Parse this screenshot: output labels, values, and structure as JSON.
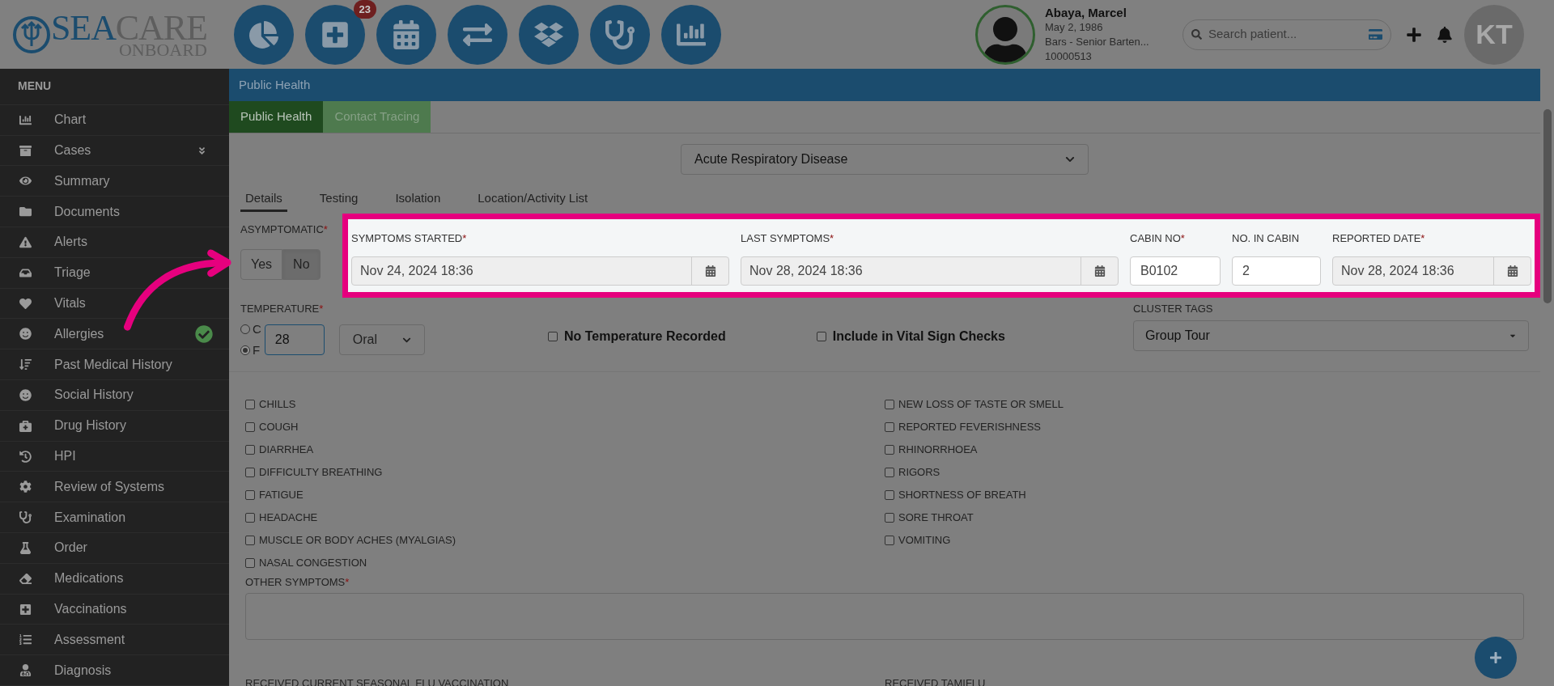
{
  "logo": {
    "part_a": "SEA",
    "part_b": "CARE",
    "sub": "ONBOARD"
  },
  "toolbar": {
    "badge": "23"
  },
  "patient": {
    "name": "Abaya, Marcel",
    "dob": "May 2, 1986",
    "role": "Bars - Senior Barten...",
    "id": "10000513"
  },
  "search": {
    "placeholder": "Search patient..."
  },
  "user": {
    "initials": "KT"
  },
  "sidebar": {
    "title": "MENU",
    "items": [
      {
        "label": "Chart",
        "expandable": false,
        "verified": false
      },
      {
        "label": "Cases",
        "expandable": true,
        "verified": false
      },
      {
        "label": "Summary",
        "expandable": false,
        "verified": false
      },
      {
        "label": "Documents",
        "expandable": false,
        "verified": false
      },
      {
        "label": "Alerts",
        "expandable": false,
        "verified": false
      },
      {
        "label": "Triage",
        "expandable": false,
        "verified": false
      },
      {
        "label": "Vitals",
        "expandable": false,
        "verified": false
      },
      {
        "label": "Allergies",
        "expandable": false,
        "verified": true
      },
      {
        "label": "Past Medical History",
        "expandable": false,
        "verified": false
      },
      {
        "label": "Social History",
        "expandable": false,
        "verified": false
      },
      {
        "label": "Drug History",
        "expandable": false,
        "verified": false
      },
      {
        "label": "HPI",
        "expandable": false,
        "verified": false
      },
      {
        "label": "Review of Systems",
        "expandable": false,
        "verified": false
      },
      {
        "label": "Examination",
        "expandable": false,
        "verified": false
      },
      {
        "label": "Order",
        "expandable": false,
        "verified": false
      },
      {
        "label": "Medications",
        "expandable": false,
        "verified": false
      },
      {
        "label": "Vaccinations",
        "expandable": false,
        "verified": false
      },
      {
        "label": "Assessment",
        "expandable": false,
        "verified": false
      },
      {
        "label": "Diagnosis",
        "expandable": false,
        "verified": false
      }
    ]
  },
  "page_title": "Public Health",
  "tabs": [
    {
      "label": "Public Health",
      "selected": true
    },
    {
      "label": "Contact Tracing",
      "selected": false
    }
  ],
  "disease_select": {
    "value": "Acute Respiratory Disease"
  },
  "subtabs": [
    {
      "label": "Details",
      "selected": true
    },
    {
      "label": "Testing",
      "selected": false
    },
    {
      "label": "Isolation",
      "selected": false
    },
    {
      "label": "Location/Activity List",
      "selected": false
    }
  ],
  "asymptomatic": {
    "label": "ASYMPTOMATIC",
    "required_mark": "*",
    "options": [
      {
        "label": "Yes",
        "selected": false
      },
      {
        "label": "No",
        "selected": true
      }
    ]
  },
  "symptom_fields": [
    {
      "label": "SYMPTOMS STARTED",
      "required_mark": "*",
      "value": "Nov 24, 2024 18:36",
      "kind": "date"
    },
    {
      "label": "LAST SYMPTOMS",
      "required_mark": "*",
      "value": "Nov 28, 2024 18:36",
      "kind": "date"
    },
    {
      "label": "CABIN NO",
      "required_mark": "*",
      "value": "B0102",
      "kind": "text"
    },
    {
      "label": "NO. IN CABIN",
      "value": "2",
      "kind": "text"
    },
    {
      "label": "REPORTED DATE",
      "required_mark": "*",
      "value": "Nov 28, 2024 18:36",
      "kind": "date"
    }
  ],
  "temperature": {
    "label": "TEMPERATURE",
    "required_mark": "*",
    "units": [
      {
        "label": "C",
        "selected": false
      },
      {
        "label": "F",
        "selected": true
      }
    ],
    "value": "28",
    "method": "Oral"
  },
  "options": [
    {
      "label": "No Temperature Recorded",
      "checked": false
    },
    {
      "label": "Include in Vital Sign Checks",
      "checked": false
    }
  ],
  "cluster_tags": {
    "label": "CLUSTER TAGS",
    "value": "Group Tour"
  },
  "symptoms": {
    "left": [
      {
        "label": "CHILLS",
        "checked": false
      },
      {
        "label": "COUGH",
        "checked": false
      },
      {
        "label": "DIARRHEA",
        "checked": false
      },
      {
        "label": "DIFFICULTY BREATHING",
        "checked": false
      },
      {
        "label": "FATIGUE",
        "checked": false
      },
      {
        "label": "HEADACHE",
        "checked": false
      },
      {
        "label": "MUSCLE OR BODY ACHES (MYALGIAS)",
        "checked": false
      },
      {
        "label": "NASAL CONGESTION",
        "checked": false
      }
    ],
    "right": [
      {
        "label": "NEW LOSS OF TASTE OR SMELL",
        "checked": false
      },
      {
        "label": "REPORTED FEVERISHNESS",
        "checked": false
      },
      {
        "label": "RHINORRHOEA",
        "checked": false
      },
      {
        "label": "RIGORS",
        "checked": false
      },
      {
        "label": "SHORTNESS OF BREATH",
        "checked": false
      },
      {
        "label": "SORE THROAT",
        "checked": false
      },
      {
        "label": "VOMITING",
        "checked": false
      }
    ]
  },
  "other_symptoms": {
    "label": "OTHER SYMPTOMS",
    "required_mark": "*"
  },
  "bottom_labels": [
    "RECEIVED CURRENT SEASONAL FLU VACCINATION",
    "RECEIVED TAMIFLU"
  ]
}
